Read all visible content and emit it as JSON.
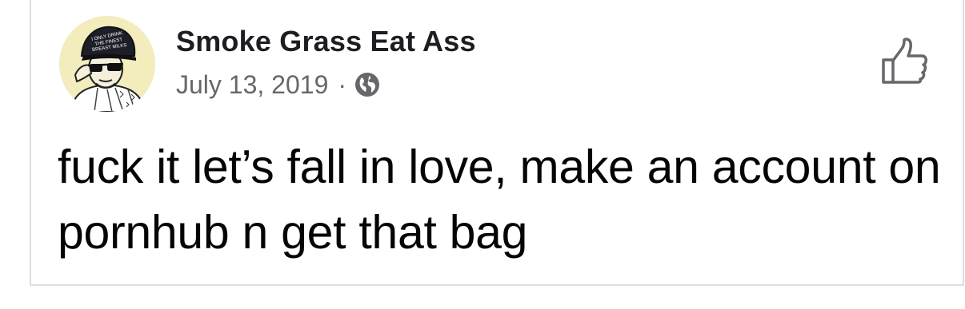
{
  "post": {
    "author_name": "Smoke Grass Eat Ass",
    "date": "July 13, 2019",
    "separator": "·",
    "privacy_icon": "globe-icon",
    "text": "fuck it let’s fall in love, make an account on pornhub n get that bag",
    "like_icon": "thumbs-up-icon",
    "avatar_cap_text": [
      "I ONLY DRINK",
      "THE FINEST",
      "BREAST MILKS"
    ]
  },
  "colors": {
    "border": "#dddfe2",
    "author": "#1c1e21",
    "meta": "#65676b",
    "text": "#050505",
    "avatar_bg": "#f3ecbd"
  }
}
